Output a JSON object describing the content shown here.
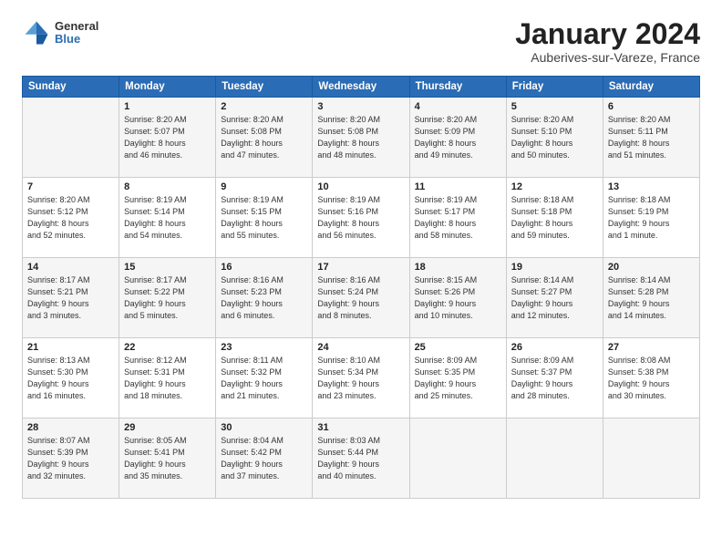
{
  "logo": {
    "general": "General",
    "blue": "Blue"
  },
  "title": {
    "month": "January 2024",
    "location": "Auberives-sur-Vareze, France"
  },
  "days_header": [
    "Sunday",
    "Monday",
    "Tuesday",
    "Wednesday",
    "Thursday",
    "Friday",
    "Saturday"
  ],
  "weeks": [
    [
      {
        "day": "",
        "info": ""
      },
      {
        "day": "1",
        "info": "Sunrise: 8:20 AM\nSunset: 5:07 PM\nDaylight: 8 hours\nand 46 minutes."
      },
      {
        "day": "2",
        "info": "Sunrise: 8:20 AM\nSunset: 5:08 PM\nDaylight: 8 hours\nand 47 minutes."
      },
      {
        "day": "3",
        "info": "Sunrise: 8:20 AM\nSunset: 5:08 PM\nDaylight: 8 hours\nand 48 minutes."
      },
      {
        "day": "4",
        "info": "Sunrise: 8:20 AM\nSunset: 5:09 PM\nDaylight: 8 hours\nand 49 minutes."
      },
      {
        "day": "5",
        "info": "Sunrise: 8:20 AM\nSunset: 5:10 PM\nDaylight: 8 hours\nand 50 minutes."
      },
      {
        "day": "6",
        "info": "Sunrise: 8:20 AM\nSunset: 5:11 PM\nDaylight: 8 hours\nand 51 minutes."
      }
    ],
    [
      {
        "day": "7",
        "info": "Sunrise: 8:20 AM\nSunset: 5:12 PM\nDaylight: 8 hours\nand 52 minutes."
      },
      {
        "day": "8",
        "info": "Sunrise: 8:19 AM\nSunset: 5:14 PM\nDaylight: 8 hours\nand 54 minutes."
      },
      {
        "day": "9",
        "info": "Sunrise: 8:19 AM\nSunset: 5:15 PM\nDaylight: 8 hours\nand 55 minutes."
      },
      {
        "day": "10",
        "info": "Sunrise: 8:19 AM\nSunset: 5:16 PM\nDaylight: 8 hours\nand 56 minutes."
      },
      {
        "day": "11",
        "info": "Sunrise: 8:19 AM\nSunset: 5:17 PM\nDaylight: 8 hours\nand 58 minutes."
      },
      {
        "day": "12",
        "info": "Sunrise: 8:18 AM\nSunset: 5:18 PM\nDaylight: 8 hours\nand 59 minutes."
      },
      {
        "day": "13",
        "info": "Sunrise: 8:18 AM\nSunset: 5:19 PM\nDaylight: 9 hours\nand 1 minute."
      }
    ],
    [
      {
        "day": "14",
        "info": "Sunrise: 8:17 AM\nSunset: 5:21 PM\nDaylight: 9 hours\nand 3 minutes."
      },
      {
        "day": "15",
        "info": "Sunrise: 8:17 AM\nSunset: 5:22 PM\nDaylight: 9 hours\nand 5 minutes."
      },
      {
        "day": "16",
        "info": "Sunrise: 8:16 AM\nSunset: 5:23 PM\nDaylight: 9 hours\nand 6 minutes."
      },
      {
        "day": "17",
        "info": "Sunrise: 8:16 AM\nSunset: 5:24 PM\nDaylight: 9 hours\nand 8 minutes."
      },
      {
        "day": "18",
        "info": "Sunrise: 8:15 AM\nSunset: 5:26 PM\nDaylight: 9 hours\nand 10 minutes."
      },
      {
        "day": "19",
        "info": "Sunrise: 8:14 AM\nSunset: 5:27 PM\nDaylight: 9 hours\nand 12 minutes."
      },
      {
        "day": "20",
        "info": "Sunrise: 8:14 AM\nSunset: 5:28 PM\nDaylight: 9 hours\nand 14 minutes."
      }
    ],
    [
      {
        "day": "21",
        "info": "Sunrise: 8:13 AM\nSunset: 5:30 PM\nDaylight: 9 hours\nand 16 minutes."
      },
      {
        "day": "22",
        "info": "Sunrise: 8:12 AM\nSunset: 5:31 PM\nDaylight: 9 hours\nand 18 minutes."
      },
      {
        "day": "23",
        "info": "Sunrise: 8:11 AM\nSunset: 5:32 PM\nDaylight: 9 hours\nand 21 minutes."
      },
      {
        "day": "24",
        "info": "Sunrise: 8:10 AM\nSunset: 5:34 PM\nDaylight: 9 hours\nand 23 minutes."
      },
      {
        "day": "25",
        "info": "Sunrise: 8:09 AM\nSunset: 5:35 PM\nDaylight: 9 hours\nand 25 minutes."
      },
      {
        "day": "26",
        "info": "Sunrise: 8:09 AM\nSunset: 5:37 PM\nDaylight: 9 hours\nand 28 minutes."
      },
      {
        "day": "27",
        "info": "Sunrise: 8:08 AM\nSunset: 5:38 PM\nDaylight: 9 hours\nand 30 minutes."
      }
    ],
    [
      {
        "day": "28",
        "info": "Sunrise: 8:07 AM\nSunset: 5:39 PM\nDaylight: 9 hours\nand 32 minutes."
      },
      {
        "day": "29",
        "info": "Sunrise: 8:05 AM\nSunset: 5:41 PM\nDaylight: 9 hours\nand 35 minutes."
      },
      {
        "day": "30",
        "info": "Sunrise: 8:04 AM\nSunset: 5:42 PM\nDaylight: 9 hours\nand 37 minutes."
      },
      {
        "day": "31",
        "info": "Sunrise: 8:03 AM\nSunset: 5:44 PM\nDaylight: 9 hours\nand 40 minutes."
      },
      {
        "day": "",
        "info": ""
      },
      {
        "day": "",
        "info": ""
      },
      {
        "day": "",
        "info": ""
      }
    ]
  ]
}
